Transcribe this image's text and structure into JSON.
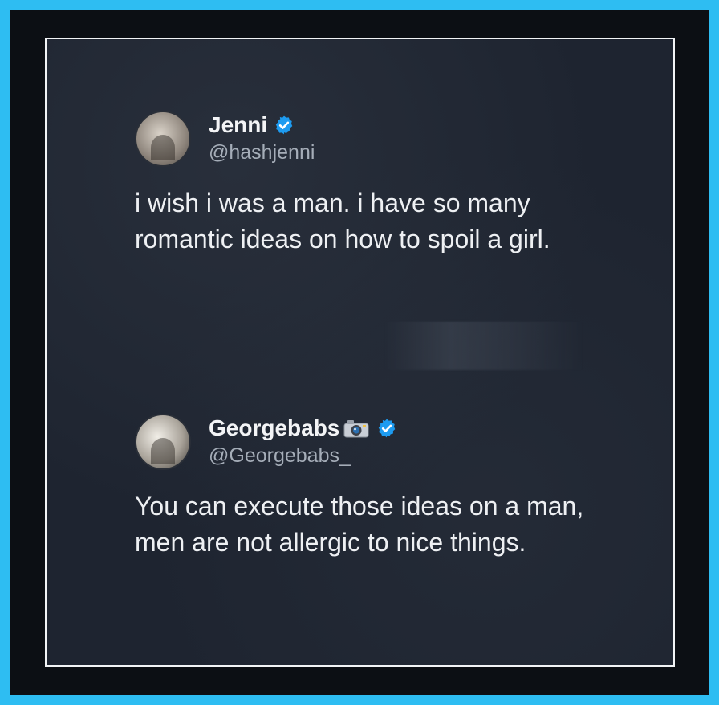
{
  "tweets": [
    {
      "display_name": "Jenni",
      "handle": "@hashjenni",
      "verified": true,
      "text": "i wish i was a man. i have so many romantic ideas on how to spoil a girl."
    },
    {
      "display_name": "Georgebabs",
      "handle": "@Georgebabs_",
      "verified": true,
      "name_emoji_icon": "camera-icon",
      "text": "You can execute those ideas on a man, men are not allergic to nice things."
    }
  ],
  "colors": {
    "frame": "#2ebdf2",
    "card_background": "#1e2430",
    "verified_badge": "#1d9bf0",
    "text_primary": "#eef0f3",
    "text_secondary": "#a5adb8"
  }
}
